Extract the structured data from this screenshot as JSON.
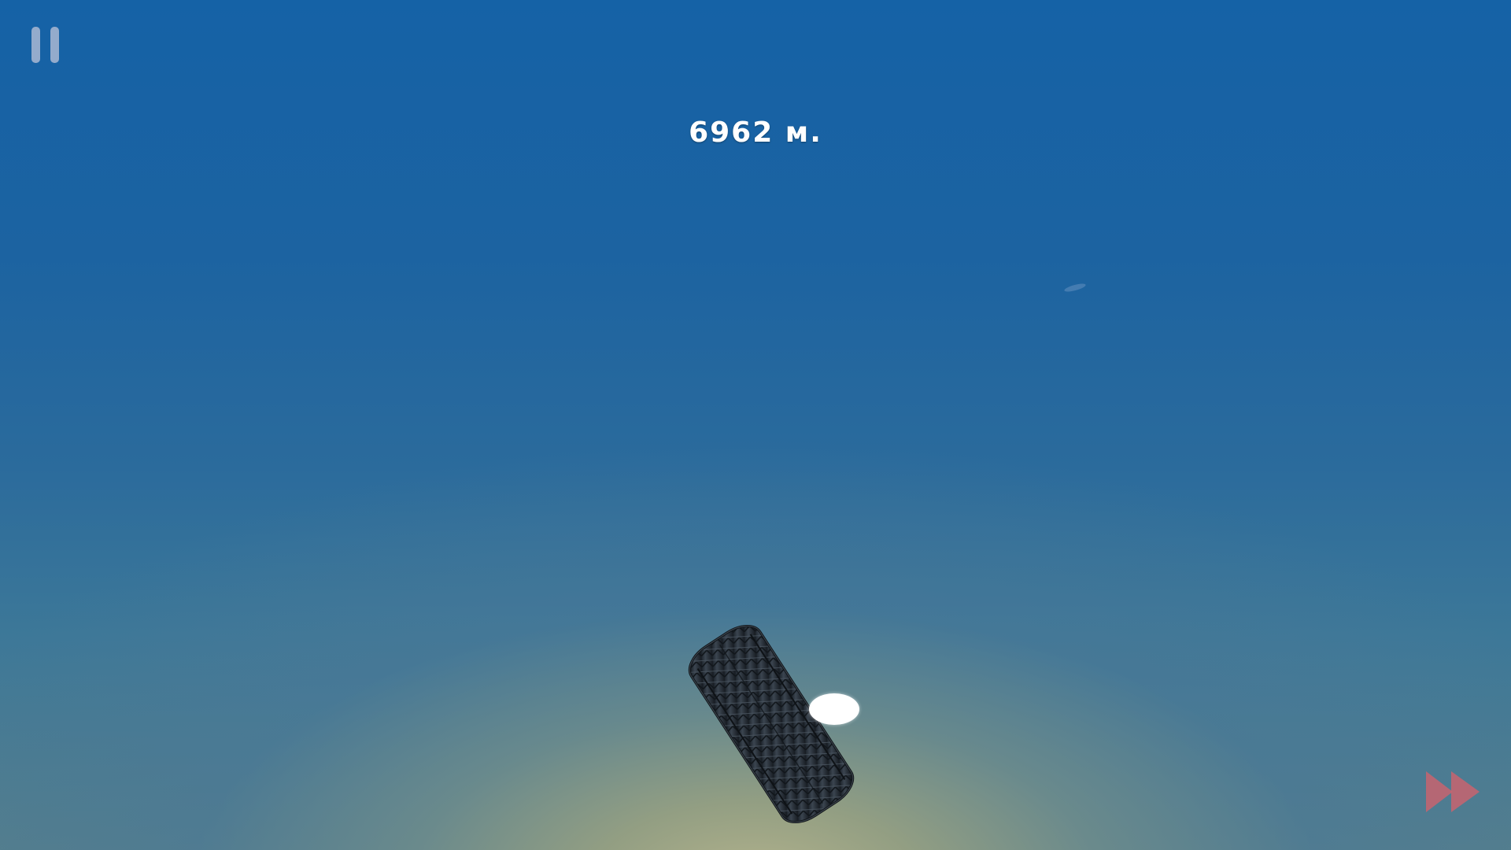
{
  "hud": {
    "distance": "6962 м."
  },
  "controls": {
    "pause_icon": "pause-icon",
    "fast_forward_icon": "fast-forward-icon"
  },
  "colors": {
    "sky_top": "#1562a6",
    "horizon_glow": "#b2b28c",
    "pause_icon": "#aab9d2",
    "fast_forward_icon": "#c8646e",
    "ball": "#ffffff",
    "tire": "#2e3640"
  }
}
